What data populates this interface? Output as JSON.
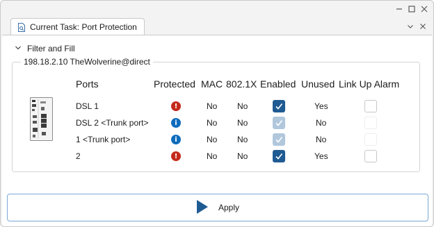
{
  "tab": {
    "title": "Current Task: Port Protection"
  },
  "filter": {
    "label": "Filter and Fill"
  },
  "device": {
    "label": "198.18.2.10 TheWolverine@direct"
  },
  "headers": {
    "ports": "Ports",
    "protected": "Protected",
    "mac": "MAC",
    "dot1x": "802.1X",
    "enabled": "Enabled",
    "unused": "Unused",
    "linkup": "Link Up Alarm"
  },
  "rows": [
    {
      "port": "DSL 1",
      "status": "error",
      "mac": "No",
      "dot1x": "No",
      "enabled": "checked",
      "unused": "Yes",
      "linkup": "unchecked"
    },
    {
      "port": "DSL 2  <Trunk port>",
      "status": "info",
      "mac": "No",
      "dot1x": "No",
      "enabled": "checked-disabled",
      "unused": "No",
      "linkup": "unchecked-disabled"
    },
    {
      "port": "1  <Trunk port>",
      "status": "info",
      "mac": "No",
      "dot1x": "No",
      "enabled": "checked-disabled",
      "unused": "No",
      "linkup": "unchecked-disabled"
    },
    {
      "port": "2",
      "status": "error",
      "mac": "No",
      "dot1x": "No",
      "enabled": "checked",
      "unused": "Yes",
      "linkup": "unchecked"
    }
  ],
  "apply": {
    "label": "Apply"
  },
  "colors": {
    "error": "#c42b1c",
    "info": "#0f6cbd",
    "accent": "#1f5b93"
  }
}
